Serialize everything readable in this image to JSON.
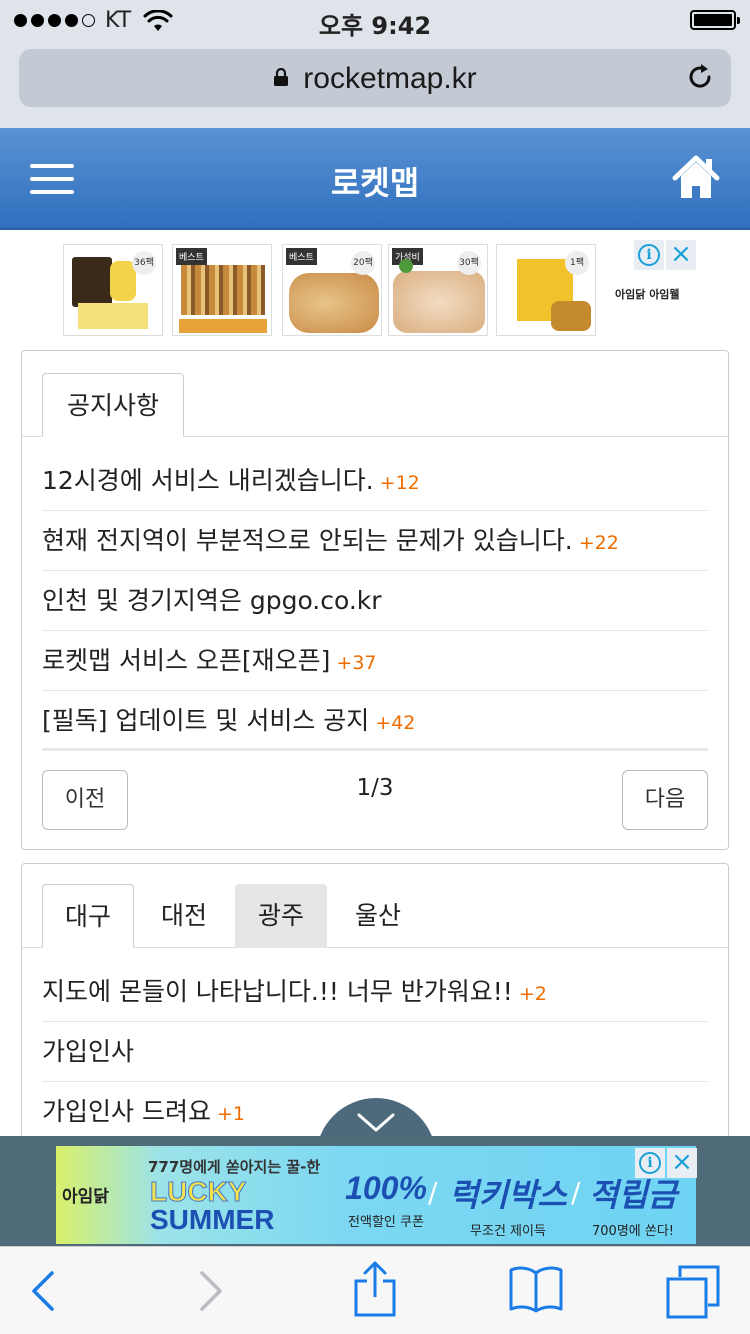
{
  "status_bar": {
    "carrier": "KT",
    "time": "오후 9:42",
    "signal_bars": 4,
    "battery_level": 1.0
  },
  "browser": {
    "url": "rocketmap.kr"
  },
  "header": {
    "title": "로켓맵"
  },
  "top_ad": {
    "tiles": [
      {
        "tag": "",
        "badge": "36팩"
      },
      {
        "tag": "베스트",
        "badge": ""
      },
      {
        "tag": "베스트",
        "badge": "20팩"
      },
      {
        "tag": "가성비",
        "badge": "30팩"
      },
      {
        "tag": "",
        "badge": "1팩"
      }
    ],
    "brand": "아임닭 아임웰"
  },
  "notice": {
    "tab_label": "공지사항",
    "posts": [
      {
        "title": "12시경에 서비스 내리겠습니다.",
        "count": "+12"
      },
      {
        "title": "현재 전지역이 부분적으로 안되는 문제가 있습니다.",
        "count": "+22"
      },
      {
        "title": "인천 및 경기지역은 gpgo.co.kr",
        "count": ""
      },
      {
        "title": "로켓맵 서비스 오픈[재오픈]",
        "count": "+37"
      },
      {
        "title": "[필독] 업데이트 및 서비스 공지",
        "count": "+42"
      }
    ],
    "prev_label": "이전",
    "next_label": "다음",
    "pager": "1/3"
  },
  "region": {
    "tabs": [
      {
        "label": "대구"
      },
      {
        "label": "대전"
      },
      {
        "label": "광주"
      },
      {
        "label": "울산"
      }
    ],
    "posts": [
      {
        "title": "지도에 몬들이 나타납니다.!! 너무 반가워요!!",
        "count": "+2"
      },
      {
        "title": "가입인사",
        "count": ""
      },
      {
        "title": "가입인사 드려요",
        "count": "+1"
      }
    ]
  },
  "bottom_ad": {
    "logo": "아임닭",
    "subtitle": "777명에게 쏟아지는 꿀-한",
    "lucky": "LUCKY",
    "summer": "SUMMER",
    "offer1_big": "100%",
    "offer1_small": "전액할인 쿠폰",
    "offer2_big": "럭키박스",
    "offer2_small": "무조건 제이득",
    "offer3_big": "적립금",
    "offer3_small": "700명에 쏜다!"
  },
  "icons": {
    "lock": "lock-icon",
    "reload": "reload-icon",
    "menu": "hamburger-icon",
    "home": "home-icon",
    "back": "chevron-left-icon",
    "forward": "chevron-right-icon",
    "share": "share-icon",
    "bookmarks": "book-icon",
    "tabs": "tabs-icon"
  },
  "colors": {
    "header_blue": "#3b7bc8",
    "count_orange": "#ef6c00",
    "link_blue": "#1a7ce6"
  }
}
